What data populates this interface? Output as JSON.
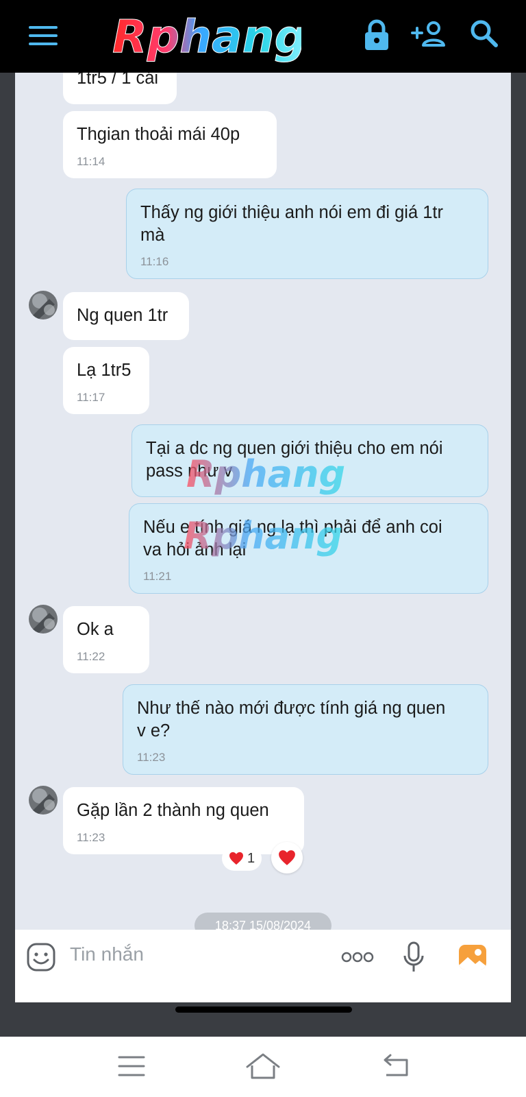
{
  "header": {
    "logo_text": "Rphang",
    "icons": [
      "menu-icon",
      "lock-icon",
      "add-user-icon",
      "search-icon"
    ]
  },
  "messages": [
    {
      "from": "contact",
      "text": "1tr5 / 1 cái",
      "time": ""
    },
    {
      "from": "contact",
      "text": "Thgian thoải mái 40p",
      "time": "11:14"
    },
    {
      "from": "me",
      "text": "Thấy ng giới thiệu anh nói em đi giá 1tr\nmà",
      "time": "11:16"
    },
    {
      "from": "contact",
      "text": "Ng quen 1tr",
      "time": ""
    },
    {
      "from": "contact",
      "text": "Lạ 1tr5",
      "time": "11:17"
    },
    {
      "from": "me",
      "text": "Tại a dc ng quen giới thiệu cho em nói\npass như v",
      "time": ""
    },
    {
      "from": "me",
      "text": "Nếu e tính giá ng lạ thì phải để anh coi\nva hỏi ảnh lại",
      "time": "11:21"
    },
    {
      "from": "contact",
      "text": "Ok a",
      "time": "11:22"
    },
    {
      "from": "me",
      "text": "Như thế nào mới được tính giá ng quen\nv e?",
      "time": "11:23"
    },
    {
      "from": "contact",
      "text": "Gặp lần 2 thành ng quen",
      "time": "11:23"
    }
  ],
  "reaction": {
    "count": "1",
    "color": "#e8242c"
  },
  "date_separator": "18:37 15/08/2024",
  "composer": {
    "placeholder": "Tin nhắn",
    "icons": [
      "sticker-icon",
      "more-icon",
      "microphone-icon",
      "image-icon"
    ]
  },
  "system_nav": {
    "icons": [
      "recent-apps-icon",
      "home-icon",
      "back-icon"
    ]
  },
  "colors": {
    "incoming_bubble": "#ffffff",
    "outgoing_bubble": "#d4ecf8",
    "chat_background": "#e4e8f0",
    "header_background": "#000000",
    "accent": "#4fb8ee"
  }
}
